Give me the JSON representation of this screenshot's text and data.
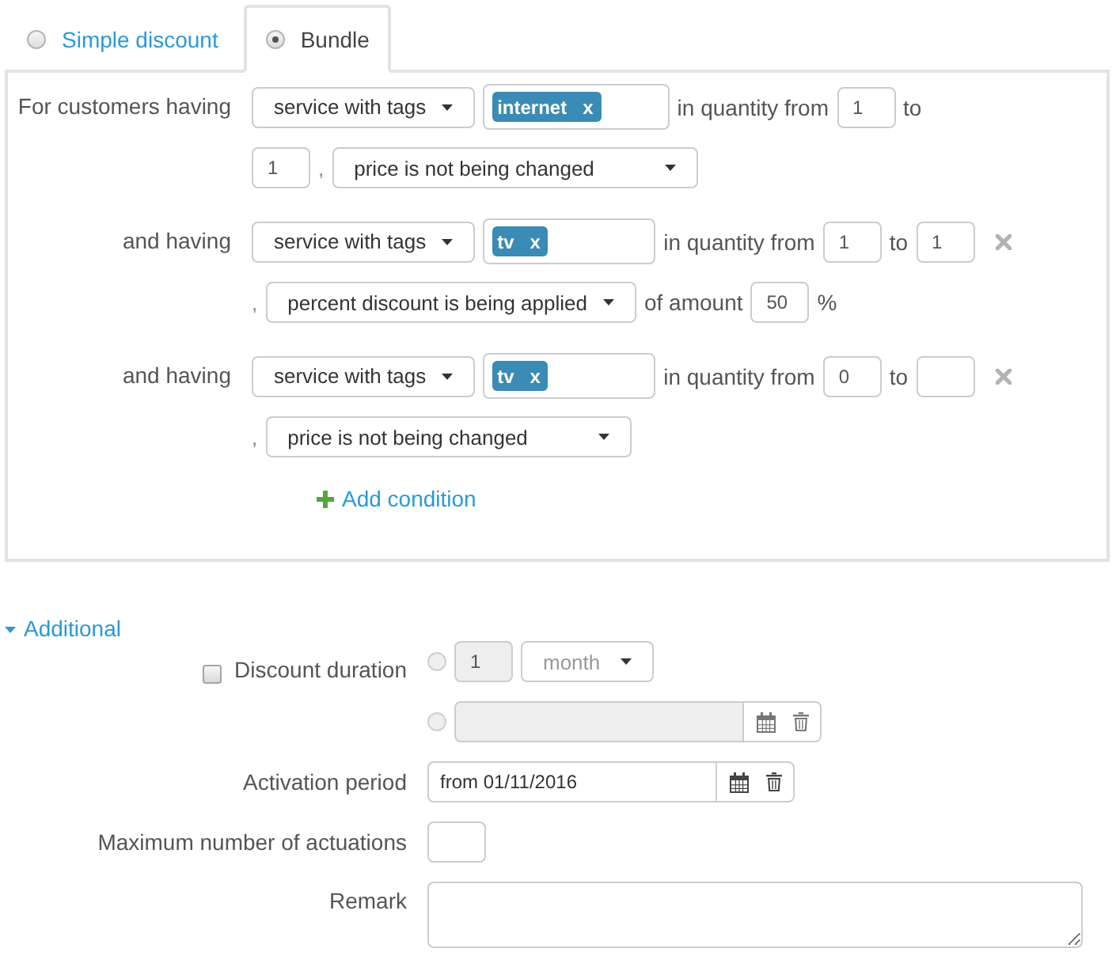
{
  "tabs": [
    {
      "label": "Simple discount",
      "selected": false
    },
    {
      "label": "Bundle",
      "selected": true
    }
  ],
  "conditions": [
    {
      "label": "For customers having",
      "removable": false,
      "lines": [
        [
          {
            "kind": "subject_select",
            "value": "service with tags"
          },
          {
            "kind": "tags",
            "tags": [
              {
                "label": "internet",
                "remove": "x"
              }
            ]
          },
          {
            "kind": "text",
            "text": "in quantity from"
          },
          {
            "kind": "input",
            "value": "1"
          },
          {
            "kind": "text",
            "text": "to"
          }
        ],
        [
          {
            "kind": "input",
            "value": "1"
          },
          {
            "kind": "separator",
            "text": ","
          },
          {
            "kind": "action_select",
            "value": "price is not being changed"
          }
        ]
      ]
    },
    {
      "label": "and having",
      "removable": true,
      "lines": [
        [
          {
            "kind": "subject_select",
            "value": "service with tags"
          },
          {
            "kind": "tags",
            "tags": [
              {
                "label": "tv",
                "remove": "x"
              }
            ]
          },
          {
            "kind": "text",
            "text": "in quantity from"
          },
          {
            "kind": "input",
            "value": "1"
          },
          {
            "kind": "text",
            "text": "to"
          },
          {
            "kind": "input",
            "value": "1"
          }
        ],
        [
          {
            "kind": "separator",
            "text": ","
          },
          {
            "kind": "action_select",
            "value": "percent discount is being applied"
          },
          {
            "kind": "text",
            "text": "of amount"
          },
          {
            "kind": "input",
            "value": "50"
          },
          {
            "kind": "text",
            "text": "%"
          }
        ]
      ]
    },
    {
      "label": "and having",
      "removable": true,
      "lines": [
        [
          {
            "kind": "subject_select",
            "value": "service with tags"
          },
          {
            "kind": "tags",
            "tags": [
              {
                "label": "tv",
                "remove": "x"
              }
            ]
          },
          {
            "kind": "text",
            "text": "in quantity from"
          },
          {
            "kind": "input",
            "value": "0"
          },
          {
            "kind": "text",
            "text": "to"
          },
          {
            "kind": "input"
          }
        ],
        [
          {
            "kind": "separator",
            "text": ","
          },
          {
            "kind": "action_select",
            "value": "price is not being changed"
          }
        ]
      ]
    }
  ],
  "add_condition": {
    "label": "Add condition"
  },
  "additional": {
    "label": "Additional",
    "expanded": true,
    "discount_duration": {
      "label": "Discount duration",
      "checked": false,
      "options": [
        {
          "kind": "period",
          "selected": false,
          "disabled": true,
          "value": "1",
          "unit": "month"
        },
        {
          "kind": "date",
          "selected": false,
          "disabled": true
        }
      ]
    },
    "activation_period": {
      "label": "Activation period",
      "value": "from 01/11/2016"
    },
    "max_actuations": {
      "label": "Maximum number of actuations"
    },
    "remark": {
      "label": "Remark"
    }
  }
}
